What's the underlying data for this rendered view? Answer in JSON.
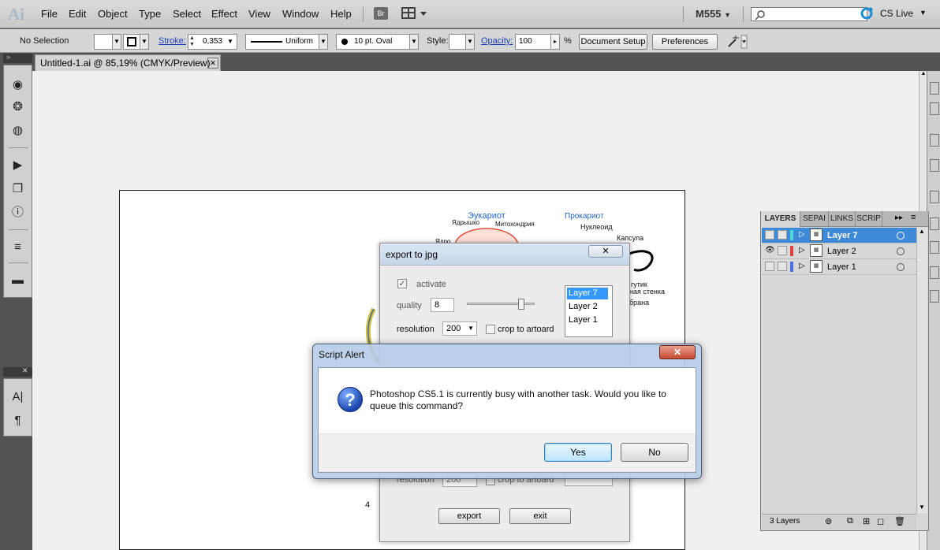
{
  "menubar": {
    "logo": "Ai",
    "items": [
      "File",
      "Edit",
      "Object",
      "Type",
      "Select",
      "Effect",
      "View",
      "Window",
      "Help"
    ],
    "bridge": "Br",
    "workspace": "M555",
    "cslive": "CS Live"
  },
  "control": {
    "selection": "No Selection",
    "stroke_label": "Stroke:",
    "stroke_value": "0,353",
    "profile": "Uniform",
    "brush": "10 pt. Oval",
    "style_label": "Style:",
    "opacity_label": "Opacity:",
    "opacity_value": "100",
    "percent": "%",
    "doc_setup": "Document Setup",
    "preferences": "Preferences"
  },
  "document": {
    "tab_title": "Untitled-1.ai @ 85,19% (CMYK/Preview)",
    "close_glyph": "✕"
  },
  "artwork": {
    "labels": [
      "Эукариот",
      "Ядрышко",
      "Митохондрия",
      "Прокариот",
      "Нуклеоид",
      "Капсула",
      "Ядро",
      "гутик",
      "ная стенка",
      "брана",
      "4"
    ]
  },
  "layers_panel": {
    "tabs": [
      "LAYERS",
      "SEPAI",
      "LINKS",
      "SCRIP"
    ],
    "layers": [
      {
        "name": "Layer 7",
        "color": "#4fd8d8",
        "selected": true,
        "visible": false
      },
      {
        "name": "Layer 2",
        "color": "#e04040",
        "selected": false,
        "visible": true
      },
      {
        "name": "Layer 1",
        "color": "#4a6fe0",
        "selected": false,
        "visible": false
      }
    ],
    "footer_count": "3 Layers"
  },
  "export_dialog": {
    "title": "export to jpg",
    "close_glyph": "✕",
    "activate": "activate",
    "quality_label": "quality",
    "quality_value": "8",
    "resolution_label": "resolution",
    "resolution_value": "200",
    "crop_label": "crop to artoard",
    "layers": [
      "Layer 7",
      "Layer 2",
      "Layer 1"
    ],
    "export_btn": "export",
    "exit_btn": "exit"
  },
  "alert": {
    "title": "Script Alert",
    "message": "Photoshop CS5.1 is currently busy with another task. Would you like to queue this command?",
    "yes": "Yes",
    "no": "No",
    "close_glyph": "✕",
    "icon_glyph": "?"
  }
}
